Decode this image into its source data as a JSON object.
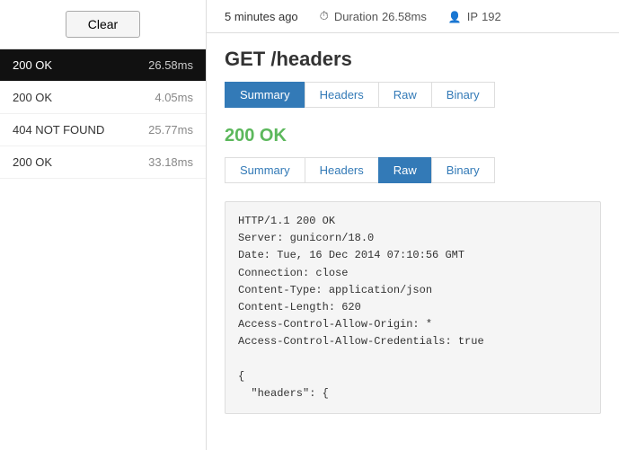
{
  "left": {
    "clear_button": "Clear",
    "requests": [
      {
        "status": "200 OK",
        "duration": "26.58ms",
        "active": true
      },
      {
        "status": "200 OK",
        "duration": "4.05ms",
        "active": false
      },
      {
        "status": "404 NOT FOUND",
        "duration": "25.77ms",
        "active": false
      },
      {
        "status": "200 OK",
        "duration": "33.18ms",
        "active": false
      }
    ]
  },
  "meta": {
    "time_ago": "5 minutes ago",
    "duration_label": "Duration",
    "duration_value": "26.58ms",
    "ip_label": "IP",
    "ip_value": "192"
  },
  "main": {
    "request_title": "GET /headers",
    "top_tabs": [
      {
        "label": "Summary",
        "active": true
      },
      {
        "label": "Headers",
        "active": false
      },
      {
        "label": "Raw",
        "active": false
      },
      {
        "label": "Binary",
        "active": false
      }
    ],
    "response": {
      "status": "200 OK",
      "bottom_tabs": [
        {
          "label": "Summary",
          "active": false
        },
        {
          "label": "Headers",
          "active": false
        },
        {
          "label": "Raw",
          "active": true
        },
        {
          "label": "Binary",
          "active": false
        }
      ],
      "raw_content": "HTTP/1.1 200 OK\nServer: gunicorn/18.0\nDate: Tue, 16 Dec 2014 07:10:56 GMT\nConnection: close\nContent-Type: application/json\nContent-Length: 620\nAccess-Control-Allow-Origin: *\nAccess-Control-Allow-Credentials: true\n\n{\n  \"headers\": {"
    }
  }
}
